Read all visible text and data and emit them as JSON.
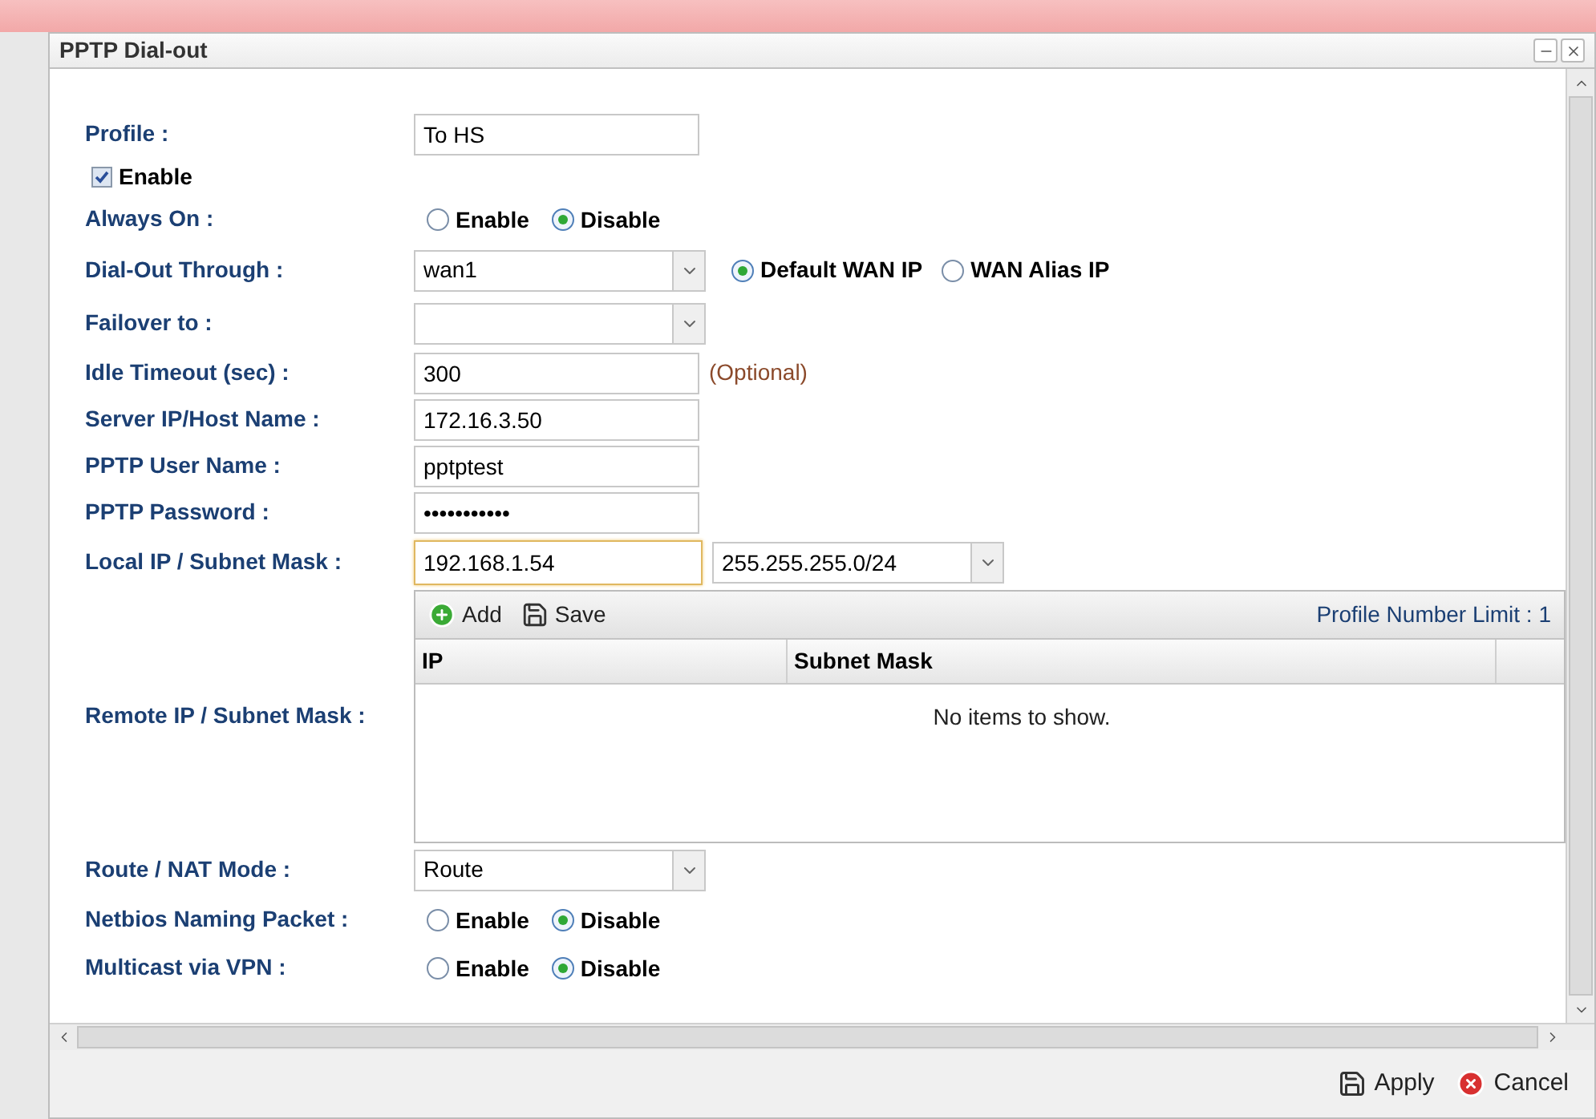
{
  "dialog": {
    "title": "PPTP Dial-out"
  },
  "fields": [
    {
      "kind": "text",
      "label": "Profile :",
      "value": "To HS"
    },
    {
      "kind": "checkbox",
      "label": "Enable",
      "checked": true
    },
    {
      "kind": "radio",
      "label": "Always On :",
      "options": [
        {
          "label": "Enable",
          "selected": false
        },
        {
          "label": "Disable",
          "selected": true
        }
      ]
    },
    {
      "kind": "select",
      "label": "Dial-Out Through :",
      "value": "wan1",
      "options": [
        {
          "label": "Default WAN IP",
          "selected": true
        },
        {
          "label": "WAN Alias IP",
          "selected": false
        }
      ]
    },
    {
      "kind": "select",
      "label": "Failover to :"
    },
    {
      "kind": "text",
      "label": "Idle Timeout (sec) :",
      "value": "300",
      "note": "(Optional)"
    },
    {
      "kind": "text",
      "label": "Server IP/Host Name :",
      "value": "172.16.3.50"
    },
    {
      "kind": "text",
      "label": "PPTP User Name :",
      "value": "pptptest"
    },
    {
      "kind": "text",
      "label": "PPTP Password :",
      "value": "•••••••••••"
    },
    {
      "kind": "ipmask",
      "label": "Local IP / Subnet Mask :",
      "value": "192.168.1.54",
      "focused": true,
      "mask": "255.255.255.0/24"
    },
    {
      "kind": "table",
      "label": "Remote IP / Subnet Mask :",
      "toolbar": [
        {
          "kind": "add",
          "label": "Add"
        },
        {
          "kind": "save",
          "label": "Save"
        }
      ],
      "limit": "Profile Number Limit : 1",
      "columns": [
        "IP",
        "Subnet Mask"
      ],
      "empty": "No items to show."
    },
    {
      "kind": "select",
      "label": "Route / NAT Mode :",
      "value": "Route"
    },
    {
      "kind": "radio",
      "label": "Netbios Naming Packet :",
      "options": [
        {
          "label": "Enable",
          "selected": false
        },
        {
          "label": "Disable",
          "selected": true
        }
      ]
    },
    {
      "kind": "radio",
      "label": "Multicast via VPN :",
      "options": [
        {
          "label": "Enable",
          "selected": false
        },
        {
          "label": "Disable",
          "selected": true
        }
      ]
    }
  ],
  "footer": [
    {
      "kind": "apply",
      "label": "Apply"
    },
    {
      "kind": "cancel",
      "label": "Cancel"
    }
  ]
}
